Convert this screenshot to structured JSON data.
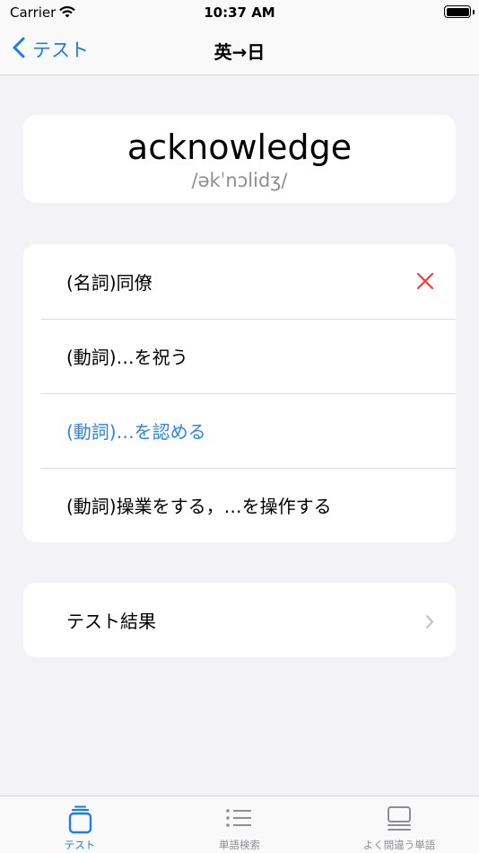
{
  "status_bar": {
    "carrier": "Carrier",
    "time": "10:37 AM"
  },
  "nav": {
    "back_label": "テスト",
    "title": "英→日"
  },
  "word": {
    "text": "acknowledge",
    "pronunciation": "/əkˈnɔlidʒ/"
  },
  "choices": [
    {
      "label": "(名詞)同僚",
      "state": "wrong"
    },
    {
      "label": "(動詞)…を祝う",
      "state": "neutral"
    },
    {
      "label": "(動詞)…を認める",
      "state": "correct"
    },
    {
      "label": "(動詞)操業をする，…を操作する",
      "state": "neutral"
    }
  ],
  "results": {
    "label": "テスト結果"
  },
  "tabs": [
    {
      "label": "テスト",
      "icon": "cards-icon",
      "active": true
    },
    {
      "label": "単語検索",
      "icon": "list-icon",
      "active": false
    },
    {
      "label": "よく間違う単語",
      "icon": "stack-icon",
      "active": false
    }
  ],
  "colors": {
    "accent": "#1a7cf0",
    "correct": "#2b84ec",
    "wrong": "#ff3b30",
    "background": "#f2f2f7"
  }
}
